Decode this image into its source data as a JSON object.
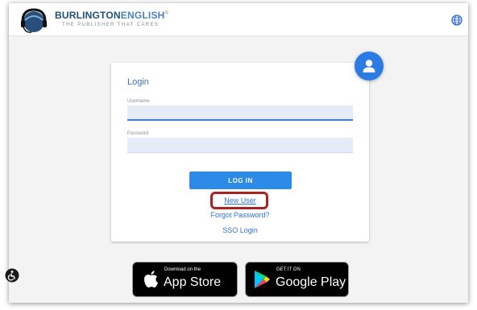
{
  "header": {
    "brand_part1": "BURLINGTON",
    "brand_part2": "ENGLISH",
    "brand_mark": "®",
    "tagline": "THE PUBLISHER THAT CARES",
    "logo_icon": "headset-globe-logo",
    "language_icon": "globe-icon"
  },
  "login": {
    "title": "Login",
    "username_label": "Username",
    "username_value": "",
    "password_label": "Password",
    "password_value": "",
    "login_button": "LOG IN",
    "new_user_link": "New User",
    "forgot_password_link": "Forgot Password?",
    "sso_link": "SSO Login",
    "avatar_icon": "user-icon",
    "highlight_color": "#a82424"
  },
  "badges": {
    "appstore_small": "Download on the",
    "appstore_big": "App Store",
    "googleplay_small": "GET IT ON",
    "googleplay_big": "Google Play"
  },
  "accessibility_icon": "accessibility-icon",
  "colors": {
    "accent": "#2b8be6",
    "link": "#2f6fd4",
    "brand": "#1f4e79"
  }
}
